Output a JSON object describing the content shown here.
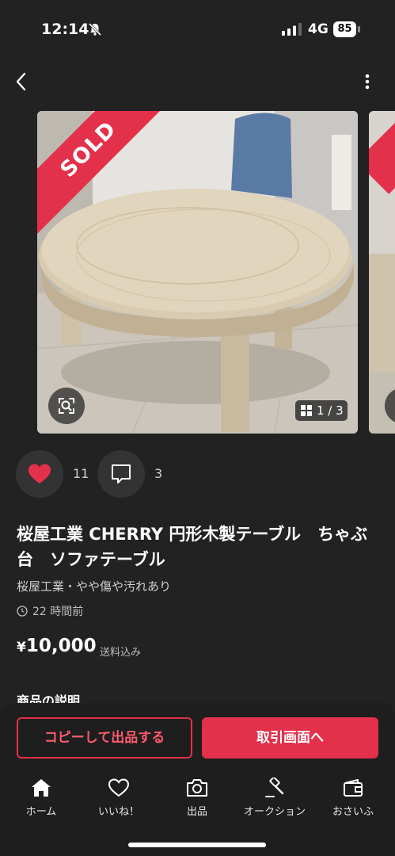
{
  "status_bar": {
    "time": "12:14",
    "network": "4G",
    "battery": "85"
  },
  "product": {
    "sold_label": "SOLD",
    "image_counter": "1 / 3",
    "likes": "11",
    "comments": "3",
    "title": "桜屋工業 CHERRY 円形木製テーブル　ちゃぶ台　ソファテーブル",
    "brand_condition": "桜屋工業・やや傷や汚れあり",
    "posted": "22 時間前",
    "price_symbol": "¥",
    "price": "10,000",
    "shipping": "送料込み",
    "description_heading": "商品の説明"
  },
  "buttons": {
    "copy_listing": "コピーして出品する",
    "transaction": "取引画面へ"
  },
  "tabs": [
    {
      "label": "ホーム",
      "icon": "home-icon"
    },
    {
      "label": "いいね！",
      "icon": "heart-icon"
    },
    {
      "label": "出品",
      "icon": "camera-icon"
    },
    {
      "label": "オークション",
      "icon": "gavel-icon"
    },
    {
      "label": "おさいふ",
      "icon": "wallet-icon"
    }
  ],
  "colors": {
    "background": "#222222",
    "accent": "#e3304b",
    "surface": "#333333"
  }
}
